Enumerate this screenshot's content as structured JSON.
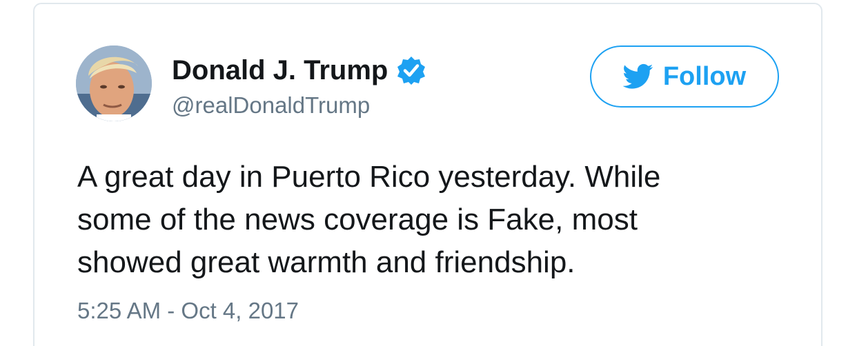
{
  "tweet": {
    "author": {
      "name": "Donald J. Trump",
      "handle": "@realDonaldTrump",
      "verified": true,
      "avatar_icon": "profile-photo"
    },
    "follow_button": {
      "label": "Follow",
      "icon": "twitter-bird-icon"
    },
    "text_lines": [
      "A great day in Puerto Rico yesterday. While",
      "some of the news coverage is Fake, most",
      "showed great warmth and friendship."
    ],
    "timestamp": "5:25 AM - Oct 4, 2017"
  },
  "colors": {
    "brand_blue": "#1da1f2",
    "text_primary": "#14171a",
    "text_secondary": "#657786",
    "card_border": "#e1e8ed"
  }
}
